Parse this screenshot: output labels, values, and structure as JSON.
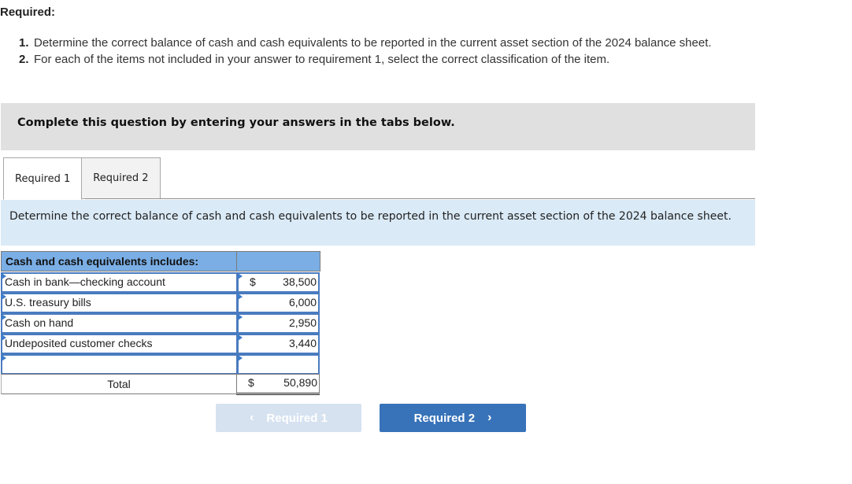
{
  "header": {
    "title": "Required:"
  },
  "requirements": [
    {
      "number": "1.",
      "text": "Determine the correct balance of cash and cash equivalents to be reported in the current asset section of the 2024 balance sheet."
    },
    {
      "number": "2.",
      "text": "For each of the items not included in your answer to requirement 1, select the correct classification of the item."
    }
  ],
  "instruction": "Complete this question by entering your answers in the tabs below.",
  "tabs": [
    {
      "label": "Required 1",
      "active": true
    },
    {
      "label": "Required 2",
      "active": false
    }
  ],
  "prompt": "Determine the correct balance of cash and cash equivalents to be reported in the current asset section of the 2024 balance sheet.",
  "table": {
    "header": "Cash and cash equivalents includes:",
    "currency_symbol": "$",
    "rows": [
      {
        "label": "Cash in bank—checking account",
        "currency": "$",
        "amount": "38,500"
      },
      {
        "label": "U.S. treasury bills",
        "currency": "",
        "amount": "6,000"
      },
      {
        "label": "Cash on hand",
        "currency": "",
        "amount": "2,950"
      },
      {
        "label": "Undeposited customer checks",
        "currency": "",
        "amount": "3,440"
      },
      {
        "label": "",
        "currency": "",
        "amount": ""
      }
    ],
    "total": {
      "label": "Total",
      "currency": "$",
      "amount": "50,890"
    }
  },
  "navigation": {
    "prev_label": "Required 1",
    "prev_icon": "chevron-left-icon",
    "prev_enabled": false,
    "next_label": "Required 2",
    "next_icon": "chevron-right-icon",
    "next_enabled": true
  },
  "colors": {
    "instruction_bg": "#e0e0e0",
    "prompt_bg": "#daeaf7",
    "table_header_bg": "#7aaee5",
    "input_border": "#4a7bbf",
    "next_button_bg": "#3873b9",
    "prev_button_bg": "#d6e2f0"
  }
}
